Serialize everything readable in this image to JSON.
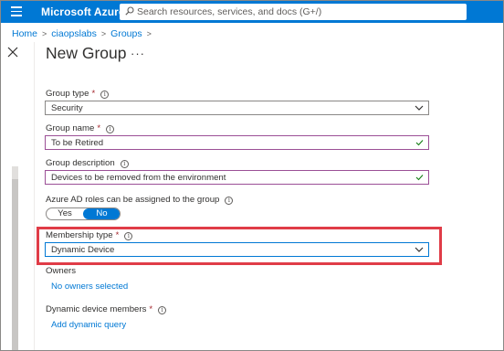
{
  "app": {
    "brand": "Microsoft Azure",
    "search_placeholder": "Search resources, services, and docs (G+/)"
  },
  "breadcrumb": [
    "Home",
    "ciaopslabs",
    "Groups"
  ],
  "header": {
    "title": "New Group",
    "more": "···"
  },
  "form": {
    "group_type": {
      "label": "Group type",
      "value": "Security"
    },
    "group_name": {
      "label": "Group name",
      "value": "To be Retired"
    },
    "group_description": {
      "label": "Group description",
      "value": "Devices to be removed from the environment"
    },
    "azure_ad_roles": {
      "label": "Azure AD roles can be assigned to the group",
      "yes": "Yes",
      "no": "No",
      "selected": "No"
    },
    "membership_type": {
      "label": "Membership type",
      "value": "Dynamic Device"
    },
    "owners": {
      "label": "Owners",
      "link": "No owners selected"
    },
    "dynamic_members": {
      "label": "Dynamic device members",
      "link": "Add dynamic query"
    }
  },
  "colors": {
    "azure_blue": "#0078d4",
    "highlight_red": "#e03c47",
    "valid_purple": "#9b4f96",
    "check_green": "#107c10"
  }
}
